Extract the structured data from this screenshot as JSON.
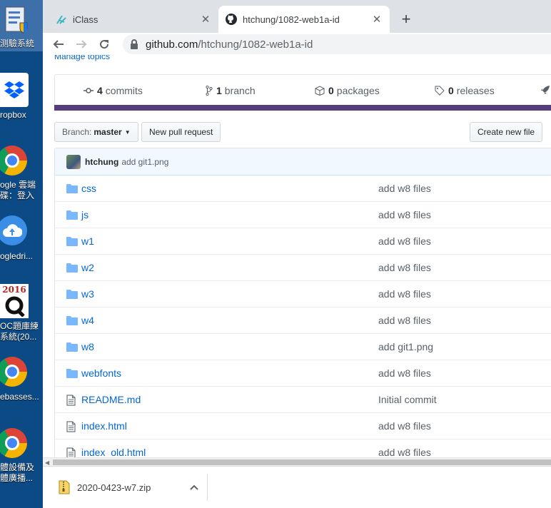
{
  "desktop": {
    "icons": [
      {
        "name": "test-system-shortcut",
        "label1": "测驗系統",
        "label2": ""
      },
      {
        "name": "dropbox-shortcut",
        "label1": "ropbox",
        "label2": ""
      },
      {
        "name": "google-cloud-shortcut",
        "label1": "ogle 雲端",
        "label2": "碟：登入"
      },
      {
        "name": "googledrive-shortcut",
        "label1": "ogledri...",
        "label2": ""
      },
      {
        "name": "question-bank-shortcut",
        "label1": "OC題庫練",
        "label2": "系統(20..."
      },
      {
        "name": "webasses-shortcut",
        "label1": "ebasses...",
        "label2": ""
      },
      {
        "name": "broadcast-shortcut",
        "label1": "體設備及",
        "label2": "體廣播..."
      }
    ],
    "badge_year": "2016"
  },
  "browser": {
    "tabs": [
      {
        "title": "iClass",
        "active": false
      },
      {
        "title": "htchung/1082-web1a-id",
        "active": true
      }
    ],
    "url_host": "github.com",
    "url_path": "/htchung/1082-web1a-id"
  },
  "repo": {
    "manage_topics": "Manage topics",
    "stats": {
      "commits_count": "4",
      "commits_label": "commits",
      "branch_count": "1",
      "branch_label": "branch",
      "packages_count": "0",
      "packages_label": "packages",
      "releases_count": "0",
      "releases_label": "releases"
    },
    "branch_prefix": "Branch:",
    "branch_name": "master",
    "new_pull_request": "New pull request",
    "create_new_file": "Create new file",
    "latest_commit": {
      "author": "htchung",
      "message": "add git1.png"
    },
    "files": [
      {
        "name": "css",
        "type": "dir",
        "message": "add w8 files"
      },
      {
        "name": "js",
        "type": "dir",
        "message": "add w8 files"
      },
      {
        "name": "w1",
        "type": "dir",
        "message": "add w8 files"
      },
      {
        "name": "w2",
        "type": "dir",
        "message": "add w8 files"
      },
      {
        "name": "w3",
        "type": "dir",
        "message": "add w8 files"
      },
      {
        "name": "w4",
        "type": "dir",
        "message": "add w8 files"
      },
      {
        "name": "w8",
        "type": "dir",
        "message": "add git1.png"
      },
      {
        "name": "webfonts",
        "type": "dir",
        "message": "add w8 files"
      },
      {
        "name": "README.md",
        "type": "file",
        "message": "Initial commit"
      },
      {
        "name": "index.html",
        "type": "file",
        "message": "add w8 files"
      },
      {
        "name": "index_old.html",
        "type": "file",
        "message": "add w8 files"
      }
    ],
    "language_bar_color": "#563d7c"
  },
  "downloads": {
    "filename": "2020-0423-w7.zip"
  }
}
